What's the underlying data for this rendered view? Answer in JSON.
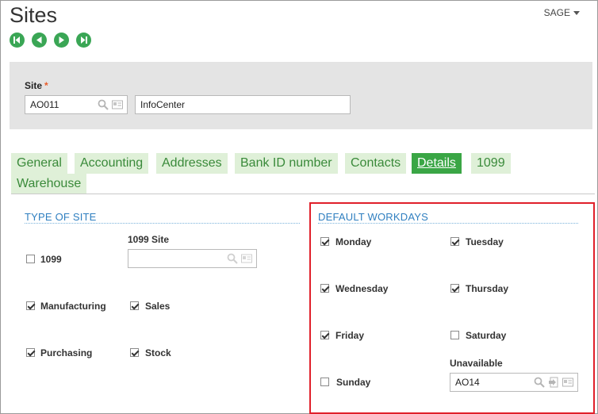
{
  "header": {
    "title": "Sites",
    "company": "SAGE"
  },
  "nav": {
    "first": "first-record",
    "prev": "previous-record",
    "next": "next-record",
    "last": "last-record"
  },
  "site_panel": {
    "label": "Site",
    "required_mark": "*",
    "code": "AO011",
    "description": "InfoCenter"
  },
  "tabs": [
    {
      "label": "General",
      "active": false
    },
    {
      "label": "Accounting",
      "active": false
    },
    {
      "label": "Addresses",
      "active": false
    },
    {
      "label": "Bank ID number",
      "active": false
    },
    {
      "label": "Contacts",
      "active": false
    },
    {
      "label": "Details",
      "active": true
    },
    {
      "label": "1099",
      "active": false
    },
    {
      "label": "Warehouse",
      "active": false
    }
  ],
  "type_of_site": {
    "title": "TYPE OF SITE",
    "site_1099_label": "1099 Site",
    "site_1099_value": "",
    "checkboxes": [
      {
        "label": "1099",
        "checked": false
      },
      {
        "label": "Manufacturing",
        "checked": true
      },
      {
        "label": "Sales",
        "checked": true
      },
      {
        "label": "Purchasing",
        "checked": true
      },
      {
        "label": "Stock",
        "checked": true
      }
    ]
  },
  "default_workdays": {
    "title": "DEFAULT WORKDAYS",
    "days": [
      {
        "label": "Monday",
        "checked": true
      },
      {
        "label": "Tuesday",
        "checked": true
      },
      {
        "label": "Wednesday",
        "checked": true
      },
      {
        "label": "Thursday",
        "checked": true
      },
      {
        "label": "Friday",
        "checked": true
      },
      {
        "label": "Saturday",
        "checked": false
      },
      {
        "label": "Sunday",
        "checked": false
      }
    ],
    "unavailable_label": "Unavailable",
    "unavailable_value": "AO14"
  },
  "colors": {
    "accent_green": "#3aa645",
    "tab_bg": "#dff0d8",
    "section_blue": "#2f7fc0",
    "highlight_red": "#e0202a"
  }
}
